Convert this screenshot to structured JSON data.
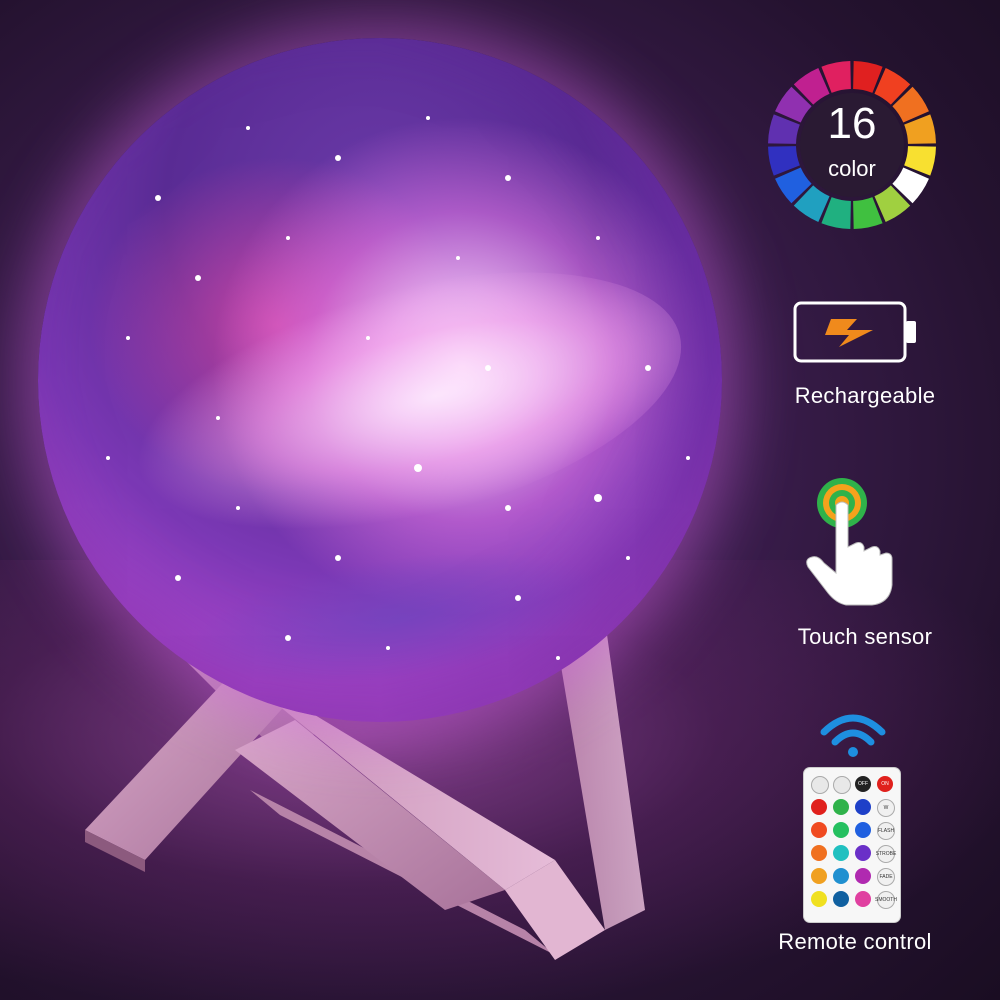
{
  "features": {
    "color_count": "16",
    "color_word": "color",
    "rechargeable_label": "Rechargeable",
    "touch_label": "Touch sensor",
    "remote_label": "Remote control"
  },
  "remote": {
    "top_buttons": [
      "",
      "",
      "OFF",
      "ON"
    ],
    "side_labels": [
      "W",
      "FLASH",
      "STROBE",
      "FADE",
      "SMOOTH"
    ]
  },
  "colors": {
    "background": "#2a1536",
    "orb_glow": "#d560e0",
    "battery_bolt": "#f08a1c",
    "touch_ring_outer": "#2fb24a",
    "touch_ring_inner": "#f5a21c",
    "wifi_blue": "#1e8fe0"
  },
  "icons": {
    "color_wheel": "color-wheel-icon",
    "battery": "battery-charging-icon",
    "touch": "touch-hand-icon",
    "wireless": "wireless-signal-icon",
    "remote": "remote-control-icon"
  }
}
